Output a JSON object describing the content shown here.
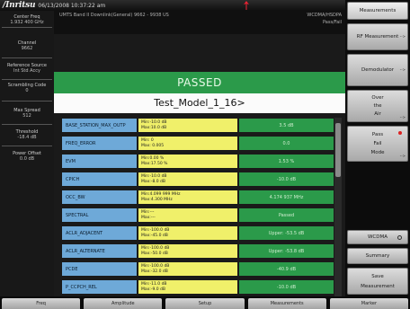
{
  "topbar": {
    "logo": "/Inritsu",
    "datetime": "06/13/2008 10:37:22 am"
  },
  "subbar": {
    "signal": "UMTS Band II Downlink(General)  9662 - 9938 US",
    "standard": "WCDMA/HSDPA",
    "passfail": "Pass/Fail"
  },
  "left_panel": [
    {
      "label": "Center Freq",
      "value": "1.932 400 GHz"
    },
    {
      "label": "Channel",
      "value": "9662"
    },
    {
      "label": "Reference Source",
      "value": "Int Std Accy"
    },
    {
      "label": "Scrambling Code",
      "value": "0"
    },
    {
      "label": "Max Spread",
      "value": "512"
    },
    {
      "label": "Threshold",
      "value": "-18.4 dB"
    },
    {
      "label": "Power Offset",
      "value": "0.0 dB"
    }
  ],
  "status": "PASSED",
  "model": "Test_Model_1_16>",
  "table": [
    {
      "name": "BASE_STATION_MAX_OUTP",
      "min": "Min:-10.0 dB",
      "max": "Max:10.0 dB",
      "value": "3.5 dB"
    },
    {
      "name": "FREQ_ERROR",
      "min": "Min:      0",
      "max": "Max:   0.005",
      "value": "0.0"
    },
    {
      "name": "EVM",
      "min": "Min:0.00 %",
      "max": "Max:17.50 %",
      "value": "1.53 %"
    },
    {
      "name": "CPICH",
      "min": "Min:-10.0 dB",
      "max": "Max:-8.0 dB",
      "value": "-10.0 dB"
    },
    {
      "name": "OCC_BW",
      "min": "Min:4.099 999 MHz",
      "max": "Max:4.300 MHz",
      "value": "4.174 937 MHz"
    },
    {
      "name": "SPECTRAL",
      "min": "Min:---",
      "max": "Max:---",
      "value": "Passed"
    },
    {
      "name": "ACLR_ADJACENT",
      "min": "Min:-100.0 dB",
      "max": "Max:-45.0 dB",
      "value": "Upper: -53.5 dB"
    },
    {
      "name": "ACLR_ALTERNATE",
      "min": "Min:-100.0 dB",
      "max": "Max:-50.0 dB",
      "value": "Upper: -53.8 dB"
    },
    {
      "name": "PCDE",
      "min": "Min:-100.0 dB",
      "max": "Max:-32.0 dB",
      "value": "-40.9 dB"
    },
    {
      "name": "P_CCPCH_REL",
      "min": "Min:-11.0 dB",
      "max": "Max:-9.0 dB",
      "value": "-10.0 dB"
    }
  ],
  "softkeys": {
    "title": "Measurements",
    "rf": "RF Measurement",
    "demod": "Demodulator",
    "ota_1": "Over",
    "ota_2": "the",
    "ota_3": "Air",
    "pf_1": "Pass",
    "pf_2": "Fail",
    "pf_3": "Mode",
    "wcdma": "WCDMA",
    "summary": "Summary",
    "save_1": "Save",
    "save_2": "Measurement",
    "arrow": "-->"
  },
  "bottom_menu": [
    "Freq",
    "Amplitude",
    "Setup",
    "Measurements",
    "Marker"
  ],
  "colors": {
    "pass_green": "#2b9a4a",
    "name_blue": "#6ea9d8",
    "limit_yellow": "#f0f06a"
  }
}
